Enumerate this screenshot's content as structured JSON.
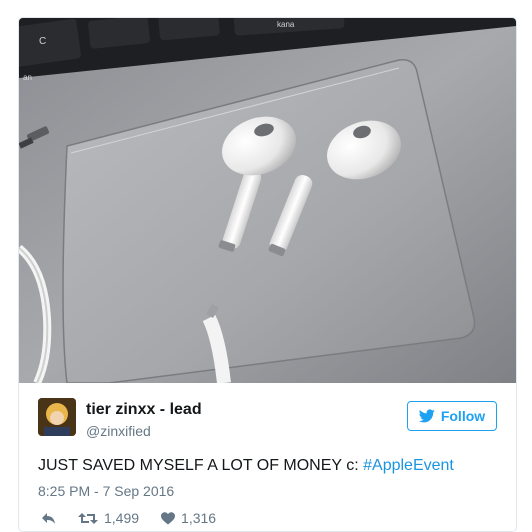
{
  "tweet": {
    "author_name": "tier zinxx - lead",
    "handle": "@zinxified",
    "follow_label": "Follow",
    "text_main": "JUST SAVED MYSELF A LOT OF MONEY c: ",
    "hashtag": "#AppleEvent",
    "timestamp": "8:25 PM - 7 Sep 2016",
    "retweets": "1,499",
    "likes": "1,316"
  },
  "photo": {
    "keyboard_keys": [
      "C",
      "kana",
      "an"
    ]
  },
  "icons": {
    "reply": "reply-icon",
    "retweet": "retweet-icon",
    "like": "heart-icon",
    "follow": "twitter-bird-icon"
  },
  "colors": {
    "accent": "#1da1f2",
    "hashtag": "#1b95e0",
    "secondary_text": "#657786"
  }
}
